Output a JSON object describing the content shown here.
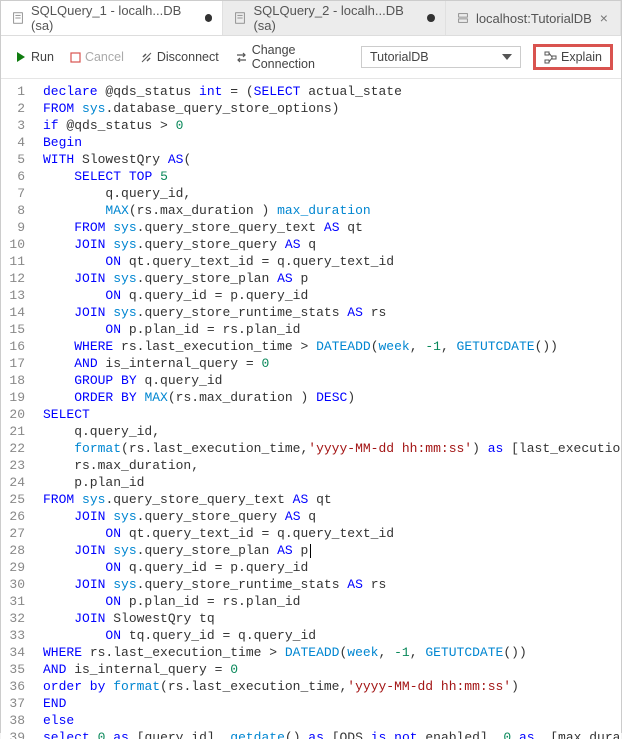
{
  "tabs": [
    {
      "label": "SQLQuery_1 - localh...DB (sa)",
      "modified": true,
      "active": true
    },
    {
      "label": "SQLQuery_2 - localh...DB (sa)",
      "modified": true,
      "active": false
    },
    {
      "label": "localhost:TutorialDB",
      "modified": false,
      "active": false
    }
  ],
  "toolbar": {
    "run": "Run",
    "cancel": "Cancel",
    "disconnect": "Disconnect",
    "change_conn": "Change Connection",
    "db_selected": "TutorialDB",
    "explain": "Explain"
  },
  "code": {
    "lines": [
      {
        "n": 1,
        "segs": [
          {
            "t": "declare",
            "c": "k"
          },
          {
            "t": " @qds_status "
          },
          {
            "t": "int",
            "c": "k"
          },
          {
            "t": " = ("
          },
          {
            "t": "SELECT",
            "c": "k"
          },
          {
            "t": " actual_state"
          }
        ]
      },
      {
        "n": 2,
        "segs": [
          {
            "t": "FROM",
            "c": "k"
          },
          {
            "t": " "
          },
          {
            "t": "sys",
            "c": "m"
          },
          {
            "t": ".database_query_store_options)"
          }
        ]
      },
      {
        "n": 3,
        "segs": [
          {
            "t": "if",
            "c": "k"
          },
          {
            "t": " @qds_status > "
          },
          {
            "t": "0",
            "c": "n"
          }
        ]
      },
      {
        "n": 4,
        "segs": [
          {
            "t": "Begin",
            "c": "k"
          }
        ]
      },
      {
        "n": 5,
        "segs": [
          {
            "t": "WITH",
            "c": "k"
          },
          {
            "t": " SlowestQry "
          },
          {
            "t": "AS",
            "c": "k"
          },
          {
            "t": "("
          }
        ]
      },
      {
        "n": 6,
        "segs": [
          {
            "t": "    "
          },
          {
            "t": "SELECT",
            "c": "k"
          },
          {
            "t": " "
          },
          {
            "t": "TOP",
            "c": "k"
          },
          {
            "t": " "
          },
          {
            "t": "5",
            "c": "n"
          }
        ]
      },
      {
        "n": 7,
        "segs": [
          {
            "t": "        q.query_id,"
          }
        ]
      },
      {
        "n": 8,
        "segs": [
          {
            "t": "        "
          },
          {
            "t": "MAX",
            "c": "m"
          },
          {
            "t": "(rs.max_duration ) "
          },
          {
            "t": "max_duration",
            "c": "m"
          }
        ]
      },
      {
        "n": 9,
        "segs": [
          {
            "t": "    "
          },
          {
            "t": "FROM",
            "c": "k"
          },
          {
            "t": " "
          },
          {
            "t": "sys",
            "c": "m"
          },
          {
            "t": ".query_store_query_text "
          },
          {
            "t": "AS",
            "c": "k"
          },
          {
            "t": " qt"
          }
        ]
      },
      {
        "n": 10,
        "segs": [
          {
            "t": "    "
          },
          {
            "t": "JOIN",
            "c": "k"
          },
          {
            "t": " "
          },
          {
            "t": "sys",
            "c": "m"
          },
          {
            "t": ".query_store_query "
          },
          {
            "t": "AS",
            "c": "k"
          },
          {
            "t": " q"
          }
        ]
      },
      {
        "n": 11,
        "segs": [
          {
            "t": "        "
          },
          {
            "t": "ON",
            "c": "k"
          },
          {
            "t": " qt.query_text_id = q.query_text_id"
          }
        ]
      },
      {
        "n": 12,
        "segs": [
          {
            "t": "    "
          },
          {
            "t": "JOIN",
            "c": "k"
          },
          {
            "t": " "
          },
          {
            "t": "sys",
            "c": "m"
          },
          {
            "t": ".query_store_plan "
          },
          {
            "t": "AS",
            "c": "k"
          },
          {
            "t": " p"
          }
        ]
      },
      {
        "n": 13,
        "segs": [
          {
            "t": "        "
          },
          {
            "t": "ON",
            "c": "k"
          },
          {
            "t": " q.query_id = p.query_id"
          }
        ]
      },
      {
        "n": 14,
        "segs": [
          {
            "t": "    "
          },
          {
            "t": "JOIN",
            "c": "k"
          },
          {
            "t": " "
          },
          {
            "t": "sys",
            "c": "m"
          },
          {
            "t": ".query_store_runtime_stats "
          },
          {
            "t": "AS",
            "c": "k"
          },
          {
            "t": " rs"
          }
        ]
      },
      {
        "n": 15,
        "segs": [
          {
            "t": "        "
          },
          {
            "t": "ON",
            "c": "k"
          },
          {
            "t": " p.plan_id = rs.plan_id"
          }
        ]
      },
      {
        "n": 16,
        "segs": [
          {
            "t": "    "
          },
          {
            "t": "WHERE",
            "c": "k"
          },
          {
            "t": " rs.last_execution_time > "
          },
          {
            "t": "DATEADD",
            "c": "m"
          },
          {
            "t": "("
          },
          {
            "t": "week",
            "c": "m"
          },
          {
            "t": ", "
          },
          {
            "t": "-1",
            "c": "n"
          },
          {
            "t": ", "
          },
          {
            "t": "GETUTCDATE",
            "c": "m"
          },
          {
            "t": "())"
          }
        ]
      },
      {
        "n": 17,
        "segs": [
          {
            "t": "    "
          },
          {
            "t": "AND",
            "c": "k"
          },
          {
            "t": " is_internal_query = "
          },
          {
            "t": "0",
            "c": "n"
          }
        ]
      },
      {
        "n": 18,
        "segs": [
          {
            "t": "    "
          },
          {
            "t": "GROUP BY",
            "c": "k"
          },
          {
            "t": " q.query_id"
          }
        ]
      },
      {
        "n": 19,
        "segs": [
          {
            "t": "    "
          },
          {
            "t": "ORDER BY",
            "c": "k"
          },
          {
            "t": " "
          },
          {
            "t": "MAX",
            "c": "m"
          },
          {
            "t": "(rs.max_duration ) "
          },
          {
            "t": "DESC",
            "c": "k"
          },
          {
            "t": ")"
          }
        ]
      },
      {
        "n": 20,
        "segs": [
          {
            "t": "SELECT",
            "c": "k"
          }
        ]
      },
      {
        "n": 21,
        "segs": [
          {
            "t": "    q.query_id,"
          }
        ]
      },
      {
        "n": 22,
        "segs": [
          {
            "t": "    "
          },
          {
            "t": "format",
            "c": "m"
          },
          {
            "t": "(rs.last_execution_time,"
          },
          {
            "t": "'yyyy-MM-dd hh:mm:ss'",
            "c": "s"
          },
          {
            "t": ") "
          },
          {
            "t": "as",
            "c": "k"
          },
          {
            "t": " [last_execution_time],"
          }
        ]
      },
      {
        "n": 23,
        "segs": [
          {
            "t": "    rs.max_duration,"
          }
        ]
      },
      {
        "n": 24,
        "segs": [
          {
            "t": "    p.plan_id"
          }
        ]
      },
      {
        "n": 25,
        "segs": [
          {
            "t": "FROM",
            "c": "k"
          },
          {
            "t": " "
          },
          {
            "t": "sys",
            "c": "m"
          },
          {
            "t": ".query_store_query_text "
          },
          {
            "t": "AS",
            "c": "k"
          },
          {
            "t": " qt"
          }
        ]
      },
      {
        "n": 26,
        "segs": [
          {
            "t": "    "
          },
          {
            "t": "JOIN",
            "c": "k"
          },
          {
            "t": " "
          },
          {
            "t": "sys",
            "c": "m"
          },
          {
            "t": ".query_store_query "
          },
          {
            "t": "AS",
            "c": "k"
          },
          {
            "t": " q"
          }
        ]
      },
      {
        "n": 27,
        "segs": [
          {
            "t": "        "
          },
          {
            "t": "ON",
            "c": "k"
          },
          {
            "t": " qt.query_text_id = q.query_text_id"
          }
        ]
      },
      {
        "n": 28,
        "segs": [
          {
            "t": "    "
          },
          {
            "t": "JOIN",
            "c": "k"
          },
          {
            "t": " "
          },
          {
            "t": "sys",
            "c": "m"
          },
          {
            "t": ".query_store_plan "
          },
          {
            "t": "AS",
            "c": "k"
          },
          {
            "t": " p"
          }
        ],
        "cursor": true
      },
      {
        "n": 29,
        "segs": [
          {
            "t": "        "
          },
          {
            "t": "ON",
            "c": "k"
          },
          {
            "t": " q.query_id = p.query_id"
          }
        ]
      },
      {
        "n": 30,
        "segs": [
          {
            "t": "    "
          },
          {
            "t": "JOIN",
            "c": "k"
          },
          {
            "t": " "
          },
          {
            "t": "sys",
            "c": "m"
          },
          {
            "t": ".query_store_runtime_stats "
          },
          {
            "t": "AS",
            "c": "k"
          },
          {
            "t": " rs"
          }
        ]
      },
      {
        "n": 31,
        "segs": [
          {
            "t": "        "
          },
          {
            "t": "ON",
            "c": "k"
          },
          {
            "t": " p.plan_id = rs.plan_id"
          }
        ]
      },
      {
        "n": 32,
        "segs": [
          {
            "t": "    "
          },
          {
            "t": "JOIN",
            "c": "k"
          },
          {
            "t": " SlowestQry tq"
          }
        ]
      },
      {
        "n": 33,
        "segs": [
          {
            "t": "        "
          },
          {
            "t": "ON",
            "c": "k"
          },
          {
            "t": " tq.query_id = q.query_id"
          }
        ]
      },
      {
        "n": 34,
        "segs": [
          {
            "t": "WHERE",
            "c": "k"
          },
          {
            "t": " rs.last_execution_time > "
          },
          {
            "t": "DATEADD",
            "c": "m"
          },
          {
            "t": "("
          },
          {
            "t": "week",
            "c": "m"
          },
          {
            "t": ", "
          },
          {
            "t": "-1",
            "c": "n"
          },
          {
            "t": ", "
          },
          {
            "t": "GETUTCDATE",
            "c": "m"
          },
          {
            "t": "())"
          }
        ]
      },
      {
        "n": 35,
        "segs": [
          {
            "t": "AND",
            "c": "k"
          },
          {
            "t": " is_internal_query = "
          },
          {
            "t": "0",
            "c": "n"
          }
        ]
      },
      {
        "n": 36,
        "segs": [
          {
            "t": "order by",
            "c": "k"
          },
          {
            "t": " "
          },
          {
            "t": "format",
            "c": "m"
          },
          {
            "t": "(rs.last_execution_time,"
          },
          {
            "t": "'yyyy-MM-dd hh:mm:ss'",
            "c": "s"
          },
          {
            "t": ")"
          }
        ]
      },
      {
        "n": 37,
        "segs": [
          {
            "t": "END",
            "c": "k"
          }
        ]
      },
      {
        "n": 38,
        "segs": [
          {
            "t": "else",
            "c": "k"
          }
        ]
      },
      {
        "n": 39,
        "segs": [
          {
            "t": "select",
            "c": "k"
          },
          {
            "t": " "
          },
          {
            "t": "0",
            "c": "n"
          },
          {
            "t": " "
          },
          {
            "t": "as",
            "c": "k"
          },
          {
            "t": " [query_id], "
          },
          {
            "t": "getdate",
            "c": "m"
          },
          {
            "t": "() "
          },
          {
            "t": "as",
            "c": "k"
          },
          {
            "t": " [QDS "
          },
          {
            "t": "is",
            "c": "k"
          },
          {
            "t": " "
          },
          {
            "t": "not",
            "c": "k"
          },
          {
            "t": " enabled], "
          },
          {
            "t": "0",
            "c": "n"
          },
          {
            "t": " "
          },
          {
            "t": "as",
            "c": "k"
          },
          {
            "t": "  [max_duration]"
          }
        ]
      }
    ]
  }
}
